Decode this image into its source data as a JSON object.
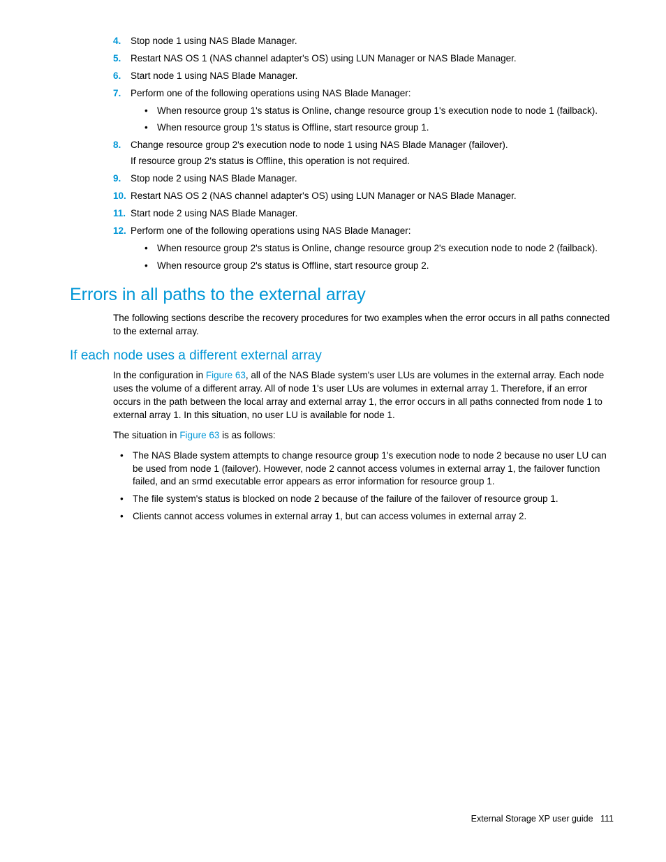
{
  "steps": {
    "s4": {
      "num": "4.",
      "text": "Stop node 1 using NAS Blade Manager."
    },
    "s5": {
      "num": "5.",
      "text": "Restart NAS OS 1 (NAS channel adapter's OS) using LUN Manager or NAS Blade Manager."
    },
    "s6": {
      "num": "6.",
      "text": "Start node 1 using NAS Blade Manager."
    },
    "s7": {
      "num": "7.",
      "text": "Perform one of the following operations using NAS Blade Manager:",
      "sub": [
        "When resource group 1's status is Online, change resource group 1's execution node to node 1 (failback).",
        "When resource group 1's status is Offline, start resource group 1."
      ]
    },
    "s8": {
      "num": "8.",
      "text": "Change resource group 2's execution node to node 1 using NAS Blade Manager (failover).",
      "extra": "If resource group 2's status is Offline, this operation is not required."
    },
    "s9": {
      "num": "9.",
      "text": "Stop node 2 using NAS Blade Manager."
    },
    "s10": {
      "num": "10.",
      "text": "Restart NAS OS 2 (NAS channel adapter's OS) using LUN Manager or NAS Blade Manager."
    },
    "s11": {
      "num": "11.",
      "text": "Start node 2 using NAS Blade Manager."
    },
    "s12": {
      "num": "12.",
      "text": "Perform one of the following operations using NAS Blade Manager:",
      "sub": [
        "When resource group 2's status is Online, change resource group 2's execution node to node 2 (failback).",
        "When resource group 2's status is Offline, start resource group 2."
      ]
    }
  },
  "h1": "Errors in all paths to the external array",
  "p1": "The following sections describe the recovery procedures for two examples when the error occurs in all paths connected to the external array.",
  "h2": "If each node uses a different external array",
  "p2a": "In the configuration in ",
  "p2link": "Figure 63",
  "p2b": ", all of the NAS Blade system's user LUs are volumes in the external array. Each node uses the volume of a different array. All of node 1's user LUs are volumes in external array 1. Therefore, if an error occurs in the path between the local array and external array 1, the error occurs in all paths connected from node 1 to external array 1. In this situation, no user LU is available for node 1.",
  "p3a": "The situation in ",
  "p3link": "Figure 63",
  "p3b": " is as follows:",
  "bullets": [
    "The NAS Blade system attempts to change resource group 1's execution node to node 2 because no user LU can be used from node 1 (failover). However, node 2 cannot access volumes in external array 1, the failover function failed, and an srmd executable error appears as error information for resource group 1.",
    "The file system's status is blocked on node 2 because of the failure of the failover of resource group 1.",
    "Clients cannot access volumes in external array 1, but can access volumes in external array 2."
  ],
  "footer": {
    "title": "External Storage XP user guide",
    "page": "111"
  }
}
